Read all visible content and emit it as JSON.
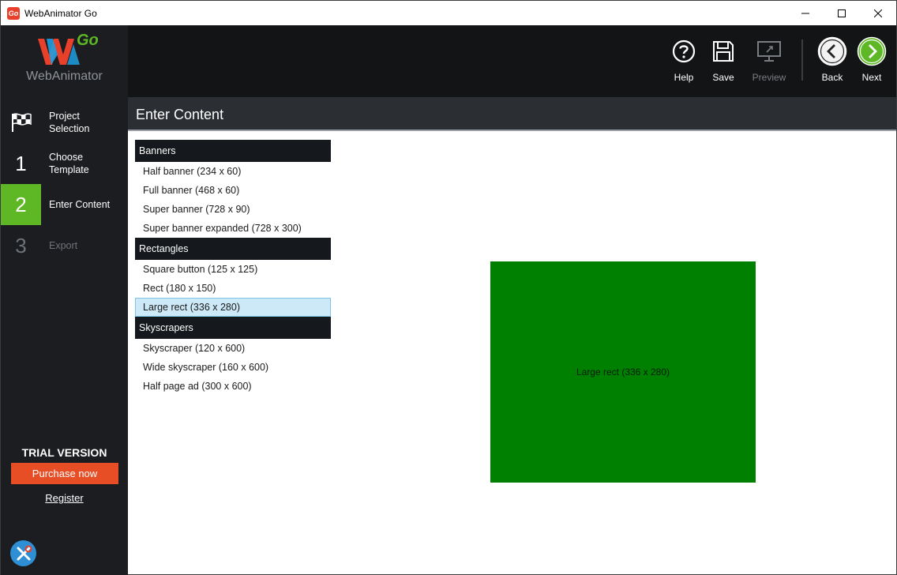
{
  "window": {
    "app_icon_text": "Go",
    "title": "WebAnimator Go"
  },
  "sidebar": {
    "logo": {
      "mark": "WA",
      "go": "Go",
      "text": "WebAnimator"
    },
    "steps": [
      {
        "num": "",
        "icon": "checkered-flag-icon",
        "label": "Project Selection",
        "state": "normal"
      },
      {
        "num": "1",
        "label": "Choose Template",
        "state": "normal"
      },
      {
        "num": "2",
        "label": "Enter Content",
        "state": "active"
      },
      {
        "num": "3",
        "label": "Export",
        "state": "disabled"
      }
    ],
    "trial_text": "TRIAL VERSION",
    "purchase_label": "Purchase now",
    "register_label": "Register",
    "tools_icon": "tools-icon"
  },
  "toolbar": {
    "help_label": "Help",
    "save_label": "Save",
    "preview_label": "Preview",
    "back_label": "Back",
    "next_label": "Next"
  },
  "content": {
    "header_title": "Enter Content",
    "groups": [
      {
        "title": "Banners",
        "items": [
          "Half banner (234 x 60)",
          "Full banner (468 x 60)",
          "Super banner (728 x 90)",
          "Super banner expanded (728 x 300)"
        ]
      },
      {
        "title": "Rectangles",
        "items": [
          "Square button (125 x 125)",
          "Rect (180 x 150)",
          "Large rect (336 x 280)"
        ]
      },
      {
        "title": "Skyscrapers",
        "items": [
          "Skyscraper (120 x 600)",
          "Wide skyscraper (160 x 600)",
          "Half page ad (300 x 600)"
        ]
      }
    ],
    "selected_item": "Large rect (336 x 280)",
    "preview_label": "Large rect (336 x 280)"
  },
  "colors": {
    "accent_green": "#5eb826",
    "purchase_orange": "#e84e25",
    "preview_green": "#008000",
    "selection_blue": "#cde8f6"
  }
}
